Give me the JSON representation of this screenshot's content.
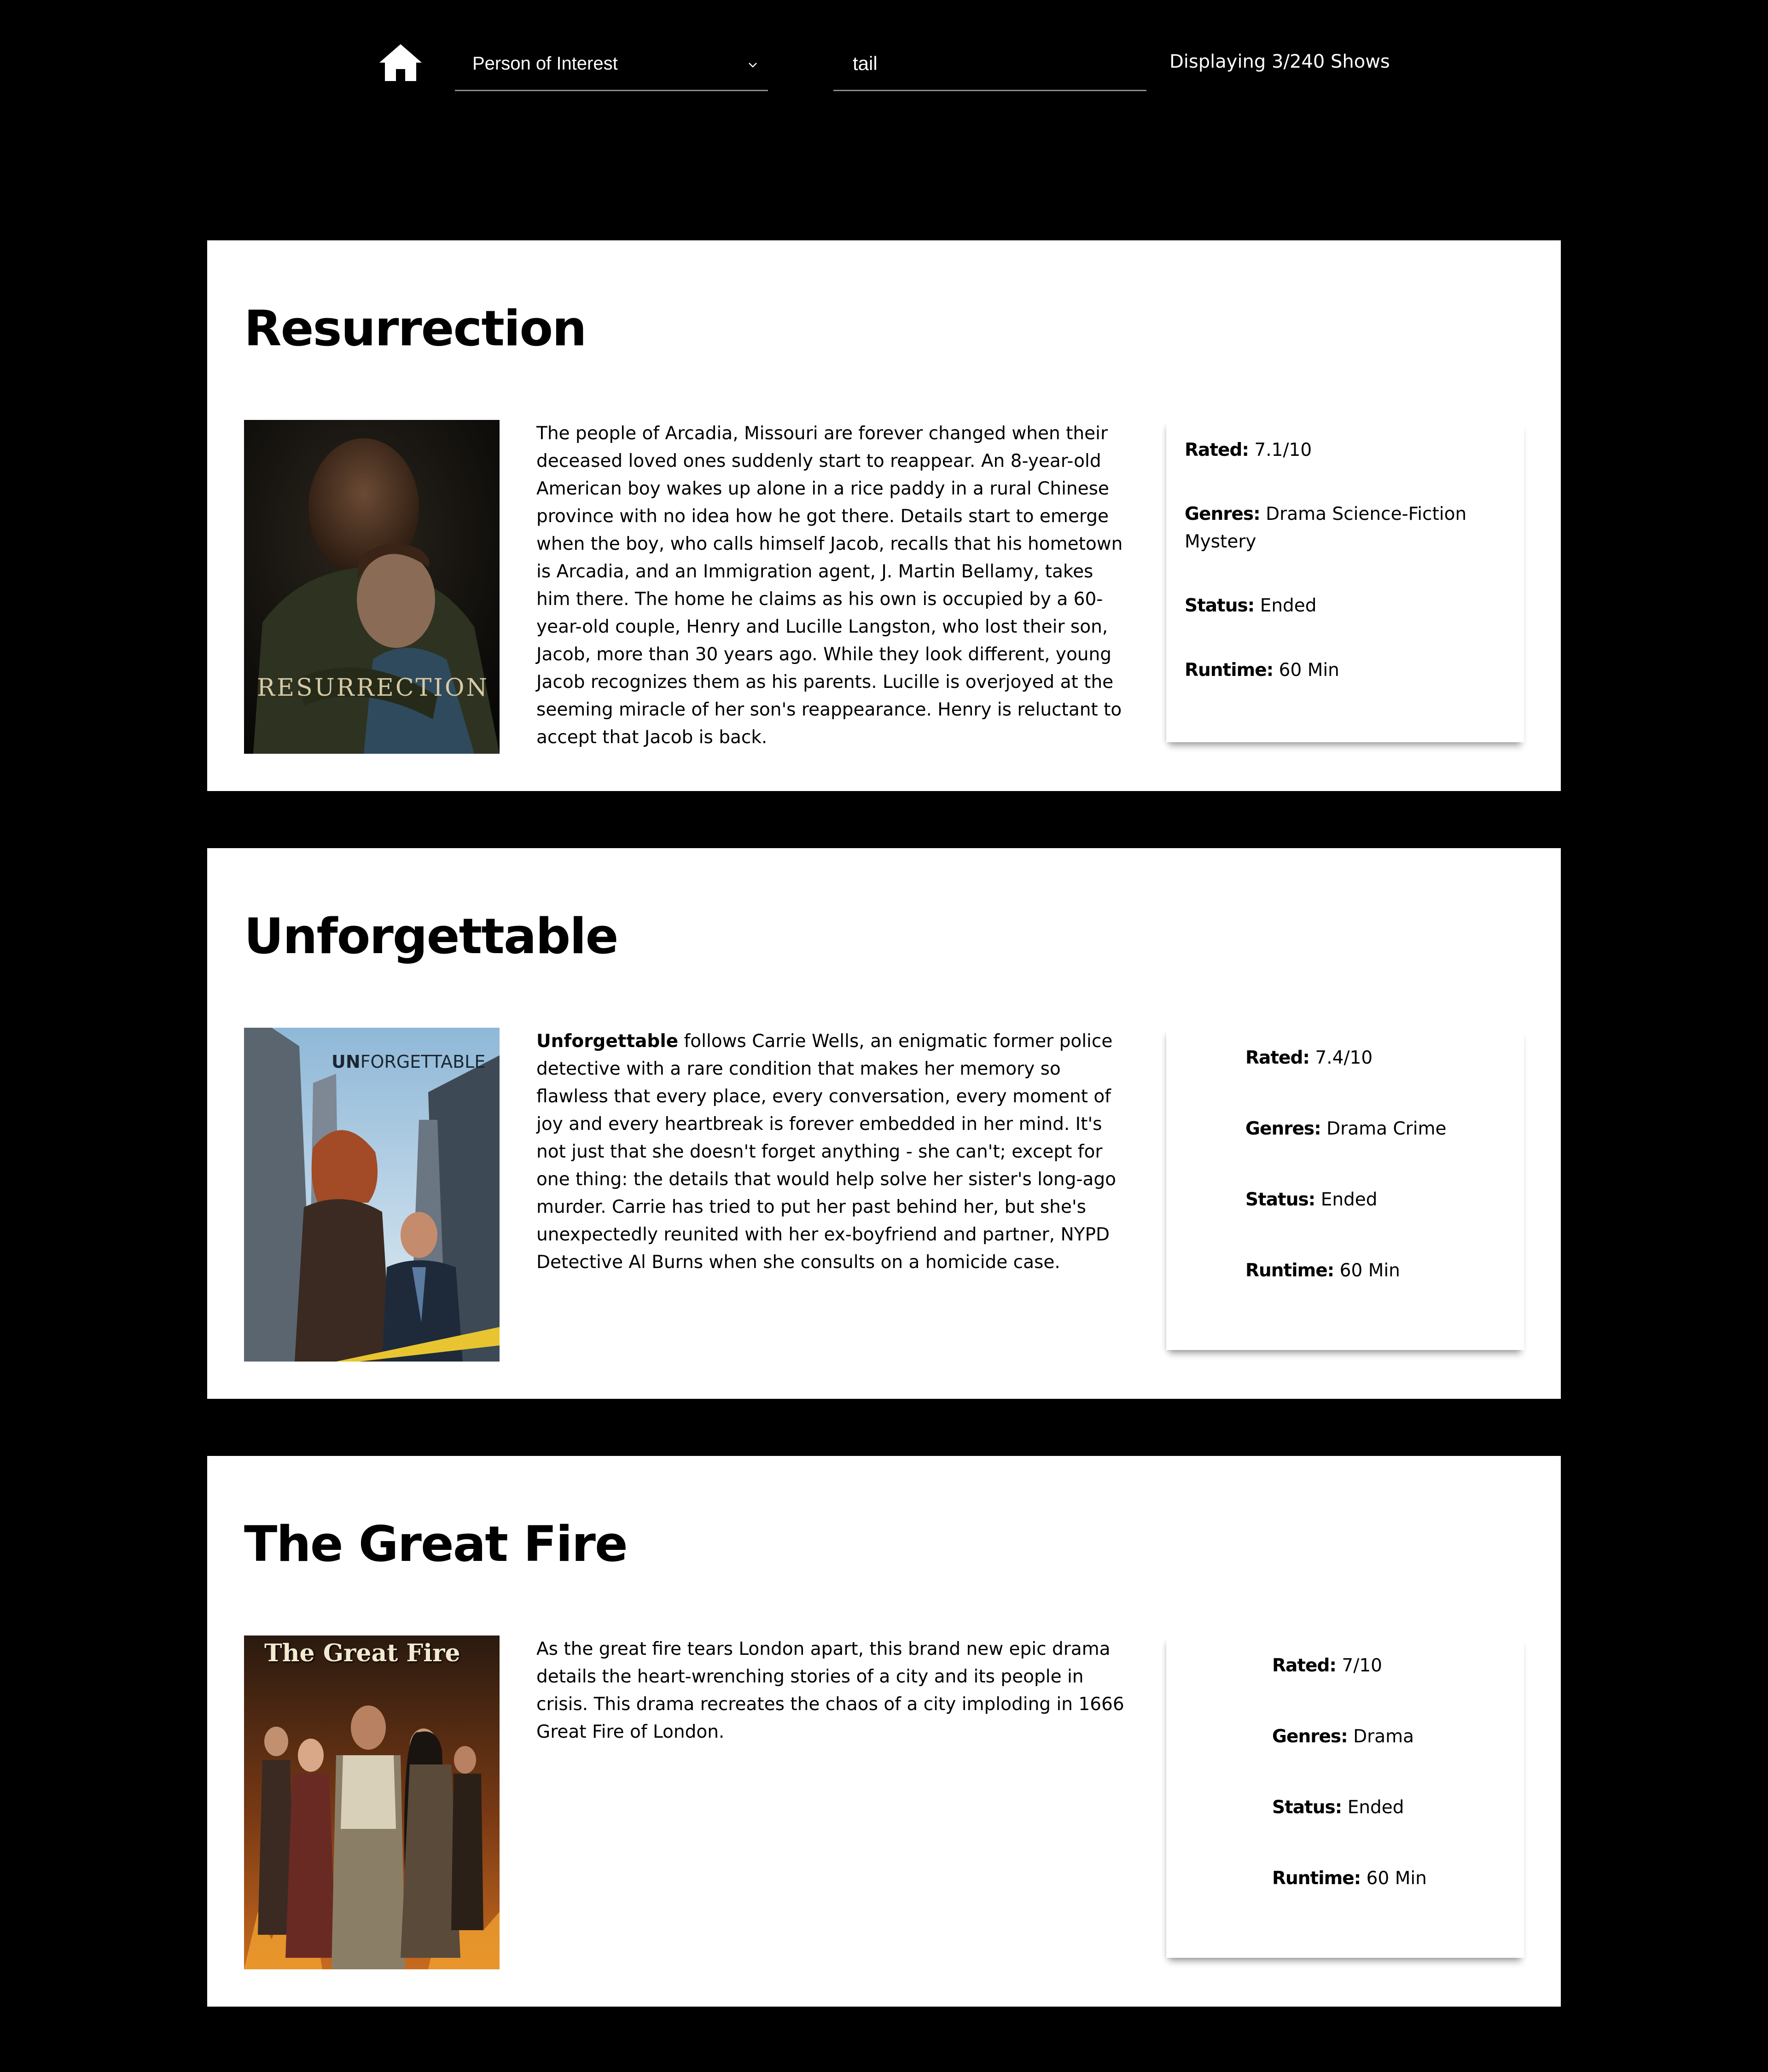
{
  "header": {
    "home_icon": "home-icon",
    "select": {
      "value": "Person of Interest",
      "icon": "chevron-down-icon"
    },
    "search": {
      "value": "tail"
    },
    "count_text": "Displaying 3/240 Shows"
  },
  "labels": {
    "rated": "Rated:",
    "genres": "Genres:",
    "status": "Status:",
    "runtime": "Runtime:"
  },
  "shows": [
    {
      "title": "Resurrection",
      "poster_text": "RESURRECTION",
      "description_bold": "",
      "description": "The people of Arcadia, Missouri are forever changed when their deceased loved ones suddenly start to reappear. An 8-year-old American boy wakes up alone in a rice paddy in a rural Chinese province with no idea how he got there. Details start to emerge when the boy, who calls himself Jacob, recalls that his hometown is Arcadia, and an Immigration agent, J. Martin Bellamy, takes him there. The home he claims as his own is occupied by a 60-year-old couple, Henry and Lucille Langston, who lost their son, Jacob, more than 30 years ago. While they look different, young Jacob recognizes them as his parents. Lucille is overjoyed at the seeming miracle of her son's reappearance. Henry is reluctant to accept that Jacob is back.",
      "rated": "7.1/10",
      "genres": "Drama Science-Fiction Mystery",
      "status": "Ended",
      "runtime": "60 Min"
    },
    {
      "title": "Unforgettable",
      "poster_text_bold": "UN",
      "poster_text": "FORGETTABLE",
      "description_bold": "Unforgettable",
      "description": " follows Carrie Wells, an enigmatic former police detective with a rare condition that makes her memory so flawless that every place, every conversation, every moment of joy and every heartbreak is forever embedded in her mind. It's not just that she doesn't forget anything - she can't; except for one thing: the details that would help solve her sister's long-ago murder. Carrie has tried to put her past behind her, but she's unexpectedly reunited with her ex-boyfriend and partner, NYPD Detective Al Burns when she consults on a homicide case.",
      "rated": "7.4/10",
      "genres": "Drama Crime",
      "status": "Ended",
      "runtime": "60 Min"
    },
    {
      "title": "The Great Fire",
      "poster_text": "The Great Fire",
      "description_bold": "",
      "description": "As the great fire tears London apart, this brand new epic drama details the heart-wrenching stories of a city and its people in crisis.  This drama recreates the chaos of a city imploding in 1666 Great Fire of London.",
      "rated": "7/10",
      "genres": "Drama",
      "status": "Ended",
      "runtime": "60 Min"
    }
  ]
}
